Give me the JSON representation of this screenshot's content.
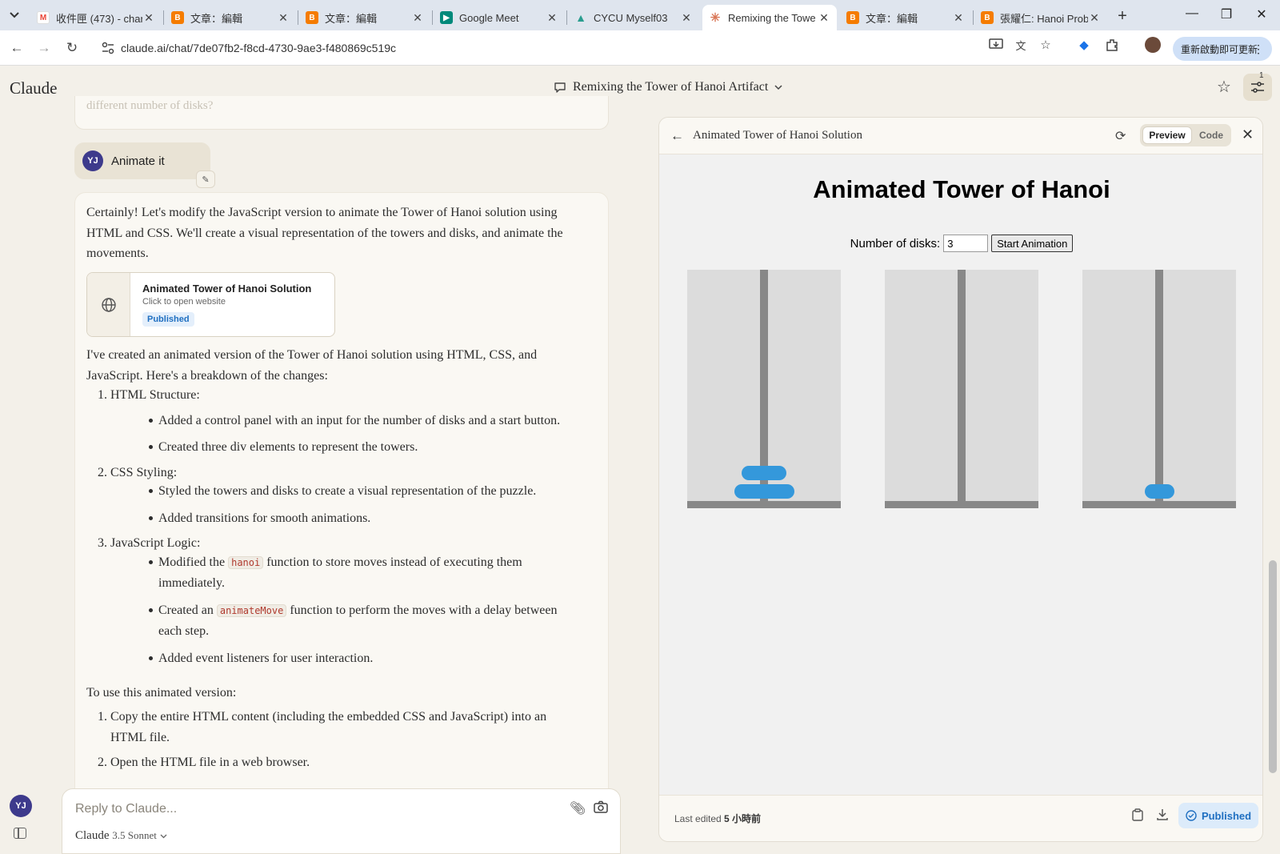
{
  "browser": {
    "tabs": [
      {
        "title": "收件匣 (473) - char",
        "favicon": "gmail-icon",
        "color": "#ea4335"
      },
      {
        "title": "文章：編輯",
        "favicon": "blogger-icon",
        "color": "#f57c00"
      },
      {
        "title": "文章：編輯",
        "favicon": "blogger-icon",
        "color": "#f57c00"
      },
      {
        "title": "Google Meet",
        "favicon": "google-meet-icon",
        "color": "#00897b"
      },
      {
        "title": "CYCU Myself03",
        "favicon": "app-icon",
        "color": "#2a9d8f"
      },
      {
        "title": "Remixing the Towe",
        "favicon": "claude-icon",
        "color": "#d97757"
      },
      {
        "title": "文章：編輯",
        "favicon": "blogger-icon",
        "color": "#f57c00"
      },
      {
        "title": "張耀仁: Hanoi Prob",
        "favicon": "blogger-icon",
        "color": "#f57c00"
      }
    ],
    "url": "claude.ai/chat/7de07fb2-f8cd-4730-9ae3-f480869c519c",
    "update_label": "重新啟動即可更新"
  },
  "app": {
    "logo": "Claude",
    "conversation_title": "Remixing the Tower of Hanoi Artifact",
    "notification_count": "1"
  },
  "chat": {
    "faded_text": "different number of disks?",
    "user_initials": "YJ",
    "user_message": "Animate it",
    "intro": "Certainly! Let's modify the JavaScript version to animate the Tower of Hanoi solution using HTML and CSS. We'll create a visual representation of the towers and disks, and animate the movements.",
    "artifact_card": {
      "title": "Animated Tower of Hanoi Solution",
      "subtitle": "Click to open website",
      "status": "Published"
    },
    "explanation": "I've created an animated version of the Tower of Hanoi solution using HTML, CSS, and JavaScript. Here's a breakdown of the changes:",
    "sections": [
      {
        "num": "1.",
        "title": "HTML Structure:"
      },
      {
        "num": "2.",
        "title": "CSS Styling:"
      },
      {
        "num": "3.",
        "title": "JavaScript Logic:"
      }
    ],
    "bullets": {
      "b1": "Added a control panel with an input for the number of disks and a start button.",
      "b2": "Created three div elements to represent the towers.",
      "b3": "Styled the towers and disks to create a visual representation of the puzzle.",
      "b4": "Added transitions for smooth animations.",
      "b5_pre": "Modified the ",
      "b5_code": "hanoi",
      "b5_post": " function to store moves instead of executing them immediately.",
      "b6_pre": "Created an ",
      "b6_code": "animateMove",
      "b6_post": " function to perform the moves with a delay between each step.",
      "b7": "Added event listeners for user interaction."
    },
    "usage_intro": "To use this animated version:",
    "usage_steps": [
      {
        "num": "1.",
        "text": "Copy the entire HTML content (including the embedded CSS and JavaScript) into an HTML file."
      },
      {
        "num": "2.",
        "text": "Open the HTML file in a web browser."
      }
    ]
  },
  "composer": {
    "placeholder": "Reply to Claude...",
    "model_name": "Claude",
    "model_version": "3.5 Sonnet"
  },
  "artifact_panel": {
    "title": "Animated Tower of Hanoi Solution",
    "preview_tab": "Preview",
    "code_tab": "Code",
    "page_heading": "Animated Tower of Hanoi",
    "disk_label": "Number of disks:",
    "disk_value": "3",
    "start_button": "Start Animation",
    "towers": [
      {
        "disks": [
          2,
          3
        ]
      },
      {
        "disks": []
      },
      {
        "disks": [
          1
        ]
      }
    ],
    "last_edited_prefix": "Last edited ",
    "last_edited_value": "5 小時前",
    "publish_label": "Published"
  }
}
